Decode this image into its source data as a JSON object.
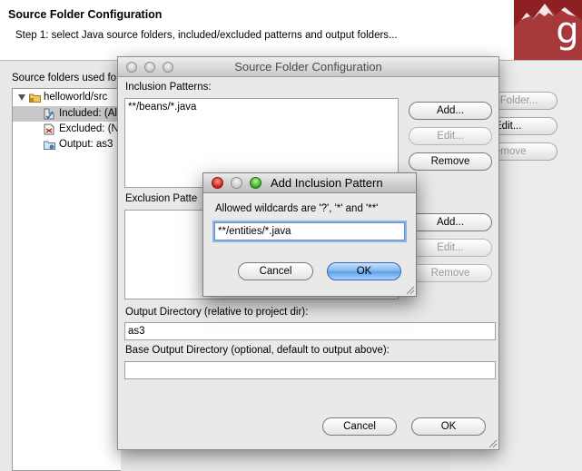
{
  "wizard": {
    "title": "Source Folder Configuration",
    "step": "Step 1: select Java source folders, included/excluded patterns and output folders...",
    "source_label": "Source folders used fo",
    "tree": [
      {
        "label": "helloworld/src",
        "icon": "source-folder-icon"
      },
      {
        "label": "Included: (Al",
        "icon": "included-filter-icon"
      },
      {
        "label": "Excluded: (N",
        "icon": "excluded-filter-icon"
      },
      {
        "label": "Output: as3",
        "icon": "output-folder-icon"
      }
    ],
    "right_buttons": {
      "add_folder": "l Folder...",
      "edit": "Edit...",
      "remove": "emove"
    }
  },
  "dialog": {
    "title": "Source Folder Configuration",
    "inclusion_label": "Inclusion Patterns:",
    "inclusion_items": [
      "**/beans/*.java"
    ],
    "exclusion_label": "Exclusion Patte",
    "buttons": {
      "add": "Add...",
      "edit": "Edit...",
      "remove": "Remove",
      "cancel": "Cancel",
      "ok": "OK"
    },
    "output_label": "Output Directory (relative to project dir):",
    "output_value": "as3",
    "base_output_label": "Base Output Directory (optional, default to output above):",
    "base_output_value": ""
  },
  "inner_dialog": {
    "title": "Add Inclusion Pattern",
    "hint": "Allowed wildcards are '?', '*' and '**'",
    "value": "**/entities/*.java",
    "cancel": "Cancel",
    "ok": "OK"
  },
  "colors": {
    "logo_bg": "#8e1f22",
    "default_button": "#5a9ee6"
  }
}
